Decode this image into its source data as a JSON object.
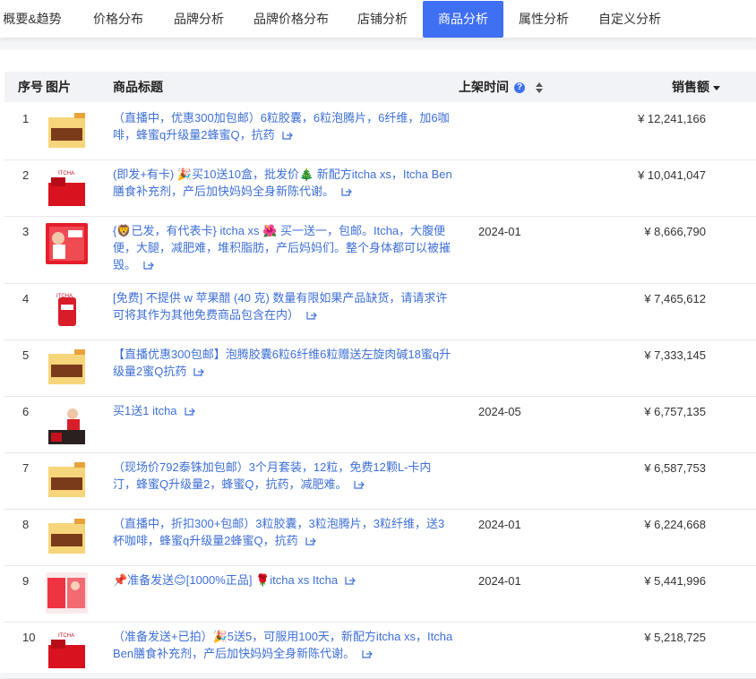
{
  "tabs": [
    {
      "label": "概要&趋势",
      "active": false
    },
    {
      "label": "价格分布",
      "active": false
    },
    {
      "label": "品牌分析",
      "active": false
    },
    {
      "label": "品牌价格分布",
      "active": false
    },
    {
      "label": "店铺分析",
      "active": false
    },
    {
      "label": "商品分析",
      "active": true
    },
    {
      "label": "属性分析",
      "active": false
    },
    {
      "label": "自定义分析",
      "active": false
    }
  ],
  "table": {
    "headers": {
      "index": "序号",
      "image": "图片",
      "title": "商品标题",
      "listed": "上架时间",
      "sales": "销售额"
    },
    "help_glyph": "?",
    "rows": [
      {
        "index": "1",
        "title": "（直播中，优惠300加包邮）6粒胶囊，6粒泡腾片，6纤维，加6咖啡，蜂蜜q升级量2蜂蜜Q，抗药",
        "listed": "",
        "sales": "¥ 12,241,166",
        "thumb": "yellow-box",
        "link_icon": "external-link-icon"
      },
      {
        "index": "2",
        "title": "(即发+有卡) 🎉买10送10盒，批发价🎄 新配方itcha xs，Itcha Ben膳食补充剂，产后加快妈妈全身新陈代谢。",
        "listed": "",
        "sales": "¥ 10,041,047",
        "thumb": "red-box",
        "link_icon": "external-link-icon"
      },
      {
        "index": "3",
        "title": "{🦁已发，有代表卡} itcha xs 🌺 买一送一，包邮。Itcha，大腹便便，大腿，减肥难，堆积脂肪，产后妈妈们。整个身体都可以被摧毁。",
        "listed": "2024-01",
        "sales": "¥ 8,666,790",
        "thumb": "red-woman",
        "link_icon": "external-link-icon"
      },
      {
        "index": "4",
        "title": "[免费] 不提供 w 苹果醋 (40 克) 数量有限如果产品缺货，请请求许可将其作为其他免费商品包含在内）",
        "listed": "",
        "sales": "¥ 7,465,612",
        "thumb": "red-pouch",
        "link_icon": "external-link-icon"
      },
      {
        "index": "5",
        "title": "【直播优惠300包邮】泡腾胶囊6粒6纤维6粒赠送左旋肉碱18蜜q升级量2蜜Q抗药",
        "listed": "",
        "sales": "¥ 7,333,145",
        "thumb": "yellow-box",
        "link_icon": "external-link-icon"
      },
      {
        "index": "6",
        "title": "买1送1 itcha",
        "listed": "2024-05",
        "sales": "¥ 6,757,135",
        "thumb": "red-woman-dark",
        "link_icon": "external-link-icon"
      },
      {
        "index": "7",
        "title": "（现场价792泰铢加包邮）3个月套装，12粒，免费12颗L-卡内汀，蜂蜜Q升级量2，蜂蜜Q，抗药，减肥难。",
        "listed": "",
        "sales": "¥ 6,587,753",
        "thumb": "yellow-box",
        "link_icon": "external-link-icon"
      },
      {
        "index": "8",
        "title": "（直播中，折扣300+包邮）3粒胶囊，3粒泡腾片，3粒纤维，送3杯咖啡，蜂蜜q升级量2蜂蜜Q，抗药",
        "listed": "2024-01",
        "sales": "¥ 6,224,668",
        "thumb": "yellow-box",
        "link_icon": "external-link-icon"
      },
      {
        "index": "9",
        "title": "📌准备发送😊[1000%正品] 🌹itcha xs Itcha",
        "listed": "2024-01",
        "sales": "¥ 5,441,996",
        "thumb": "pink-box",
        "link_icon": "external-link-icon"
      },
      {
        "index": "10",
        "title": "（准备发送+已拍）🎉5送5，可服用100天，新配方itcha xs，Itcha Ben膳食补充剂，产后加快妈妈全身新陈代谢。",
        "listed": "",
        "sales": "¥ 5,218,725",
        "thumb": "red-box",
        "link_icon": "external-link-icon"
      }
    ]
  },
  "colors": {
    "accent": "#3f6ff3",
    "link": "#3e6fd6",
    "header_bg": "#f2f3f6"
  }
}
